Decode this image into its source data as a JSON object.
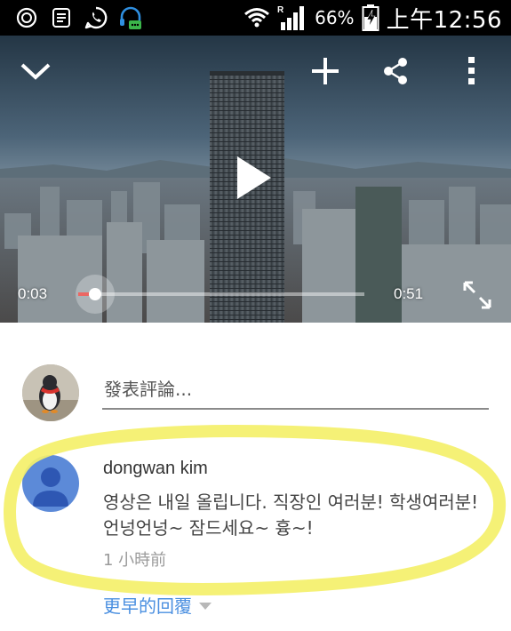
{
  "status_bar": {
    "battery_percent": "66%",
    "time": "上午12:56",
    "icons": [
      "power-icon",
      "notes-icon",
      "whatsapp-icon",
      "headset-icon",
      "wifi-icon",
      "signal-icon",
      "battery-charging-icon"
    ]
  },
  "player": {
    "current_time": "0:03",
    "duration": "0:51",
    "progress_fraction": 0.059,
    "icons": {
      "collapse": "chevron-down-icon",
      "add": "plus-icon",
      "share": "share-icon",
      "more": "more-vertical-icon",
      "play": "play-icon",
      "fullscreen": "fullscreen-icon"
    }
  },
  "compose": {
    "placeholder": "發表評論..."
  },
  "comment": {
    "author": "dongwan kim",
    "text": "영상은 내일 올립니다. 직장인 여러분! 학생여러분! 언넝언넝~ 잠드세요~ 흉~!",
    "time_ago": "1 小時前"
  },
  "replies": {
    "earlier_label": "更早的回覆"
  },
  "colors": {
    "highlight": "#f4f06a",
    "link": "#4a8fe0",
    "progress": "#e52d27",
    "avatar_blue": "#5c8ad8"
  }
}
